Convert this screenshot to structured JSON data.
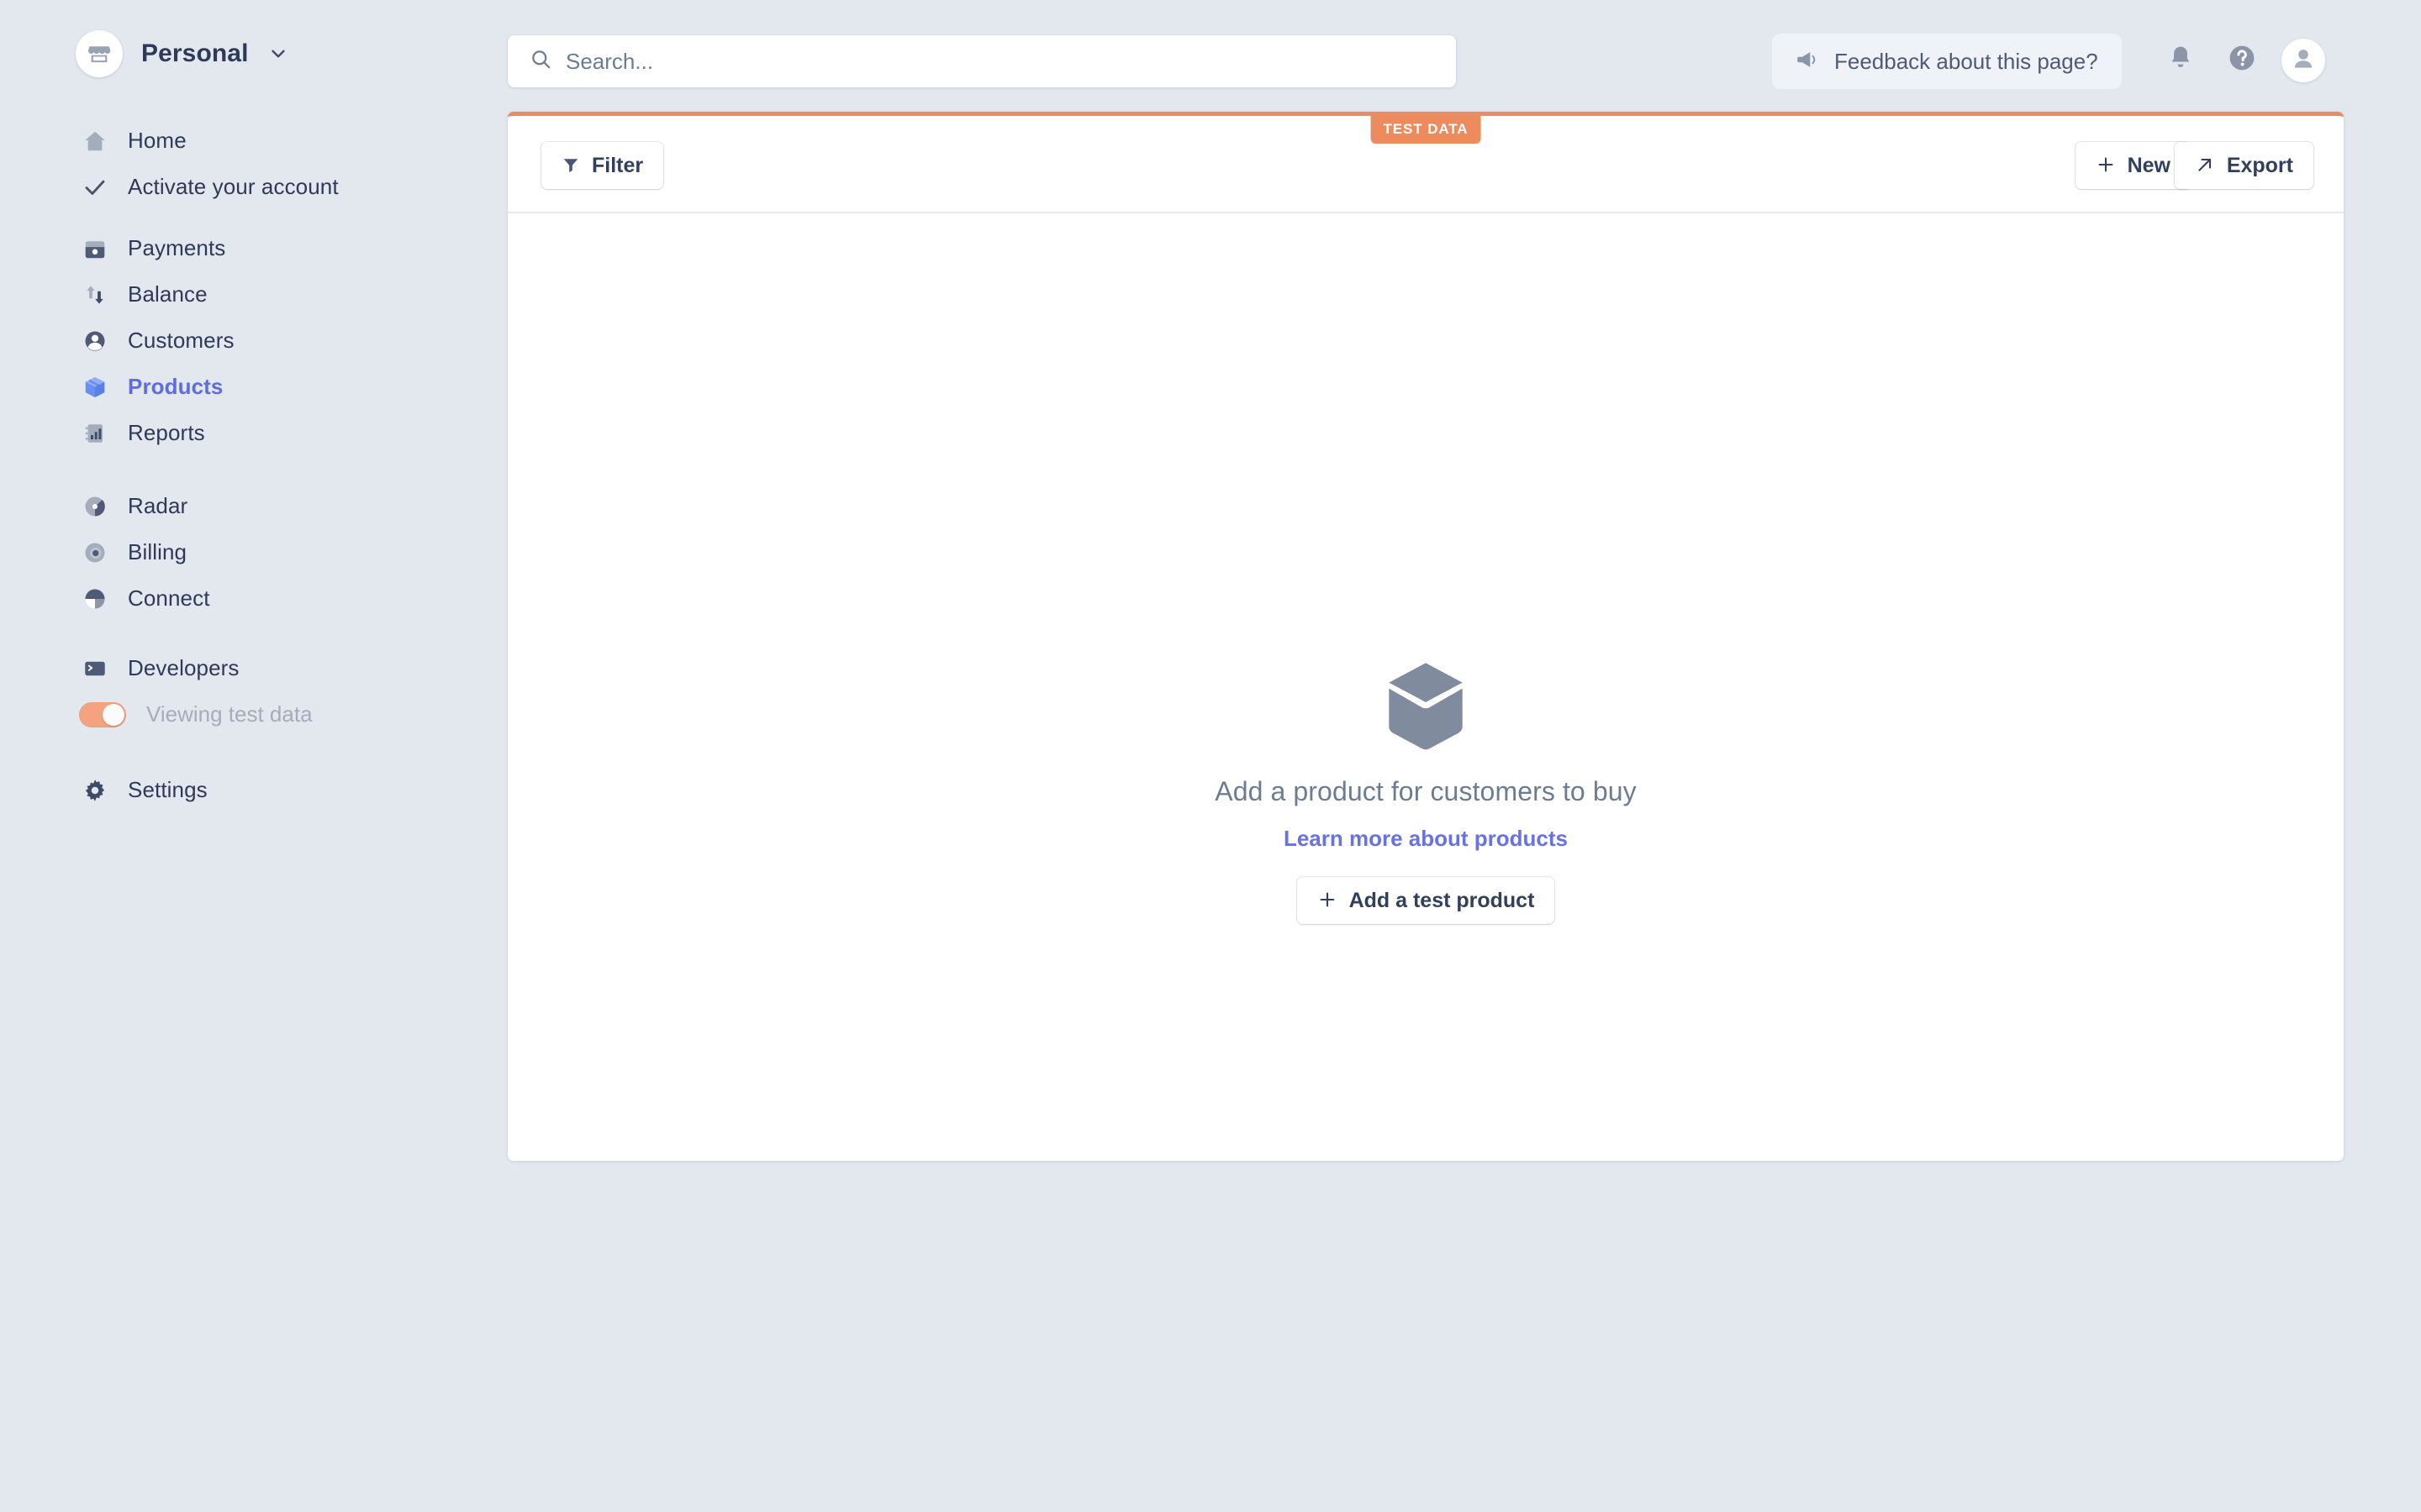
{
  "sidebar": {
    "account": {
      "name": "Personal",
      "logo_icon": "store-icon",
      "chevron_icon": "chevron-down-icon"
    },
    "groups": [
      {
        "items": [
          {
            "label": "Home",
            "icon": "home-icon",
            "active": false
          },
          {
            "label": "Activate your account",
            "icon": "check-icon",
            "active": false
          }
        ]
      },
      {
        "items": [
          {
            "label": "Payments",
            "icon": "payments-icon",
            "active": false
          },
          {
            "label": "Balance",
            "icon": "balance-arrows-icon",
            "active": false
          },
          {
            "label": "Customers",
            "icon": "customers-person-icon",
            "active": false
          },
          {
            "label": "Products",
            "icon": "products-box-icon",
            "active": true
          },
          {
            "label": "Reports",
            "icon": "reports-bars-icon",
            "active": false
          }
        ]
      },
      {
        "items": [
          {
            "label": "Radar",
            "icon": "radar-icon",
            "active": false
          },
          {
            "label": "Billing",
            "icon": "billing-icon",
            "active": false
          },
          {
            "label": "Connect",
            "icon": "connect-icon",
            "active": false
          }
        ]
      },
      {
        "items": [
          {
            "label": "Developers",
            "icon": "terminal-icon",
            "active": false
          }
        ]
      },
      {
        "items": [
          {
            "label": "Settings",
            "icon": "gear-icon",
            "active": false
          }
        ]
      }
    ],
    "test_data_toggle": {
      "label": "Viewing test data",
      "on": true,
      "color": "#f5a281"
    }
  },
  "topbar": {
    "search": {
      "placeholder": "Search...",
      "value": "",
      "icon": "search-icon"
    },
    "feedback": {
      "label": "Feedback about this page?",
      "icon": "megaphone-icon"
    },
    "notifications_icon": "bell-icon",
    "help_icon": "question-circle-icon",
    "avatar_icon": "avatar-icon"
  },
  "content": {
    "badge": "TEST DATA",
    "badge_color": "#ec8b5e",
    "toolbar": {
      "filter_label": "Filter",
      "filter_icon": "funnel-icon",
      "new_label": "New",
      "new_icon": "plus-icon",
      "export_label": "Export",
      "export_icon": "arrow-up-right-icon"
    },
    "empty_state": {
      "icon": "product-box-icon",
      "title": "Add a product for customers to buy",
      "link": "Learn more about products",
      "cta_label": "Add a test product",
      "cta_icon": "plus-icon"
    }
  },
  "colors": {
    "background": "#e3e8ee",
    "accent_blue": "#6772e5",
    "active_nav": "#5f6ce0",
    "test_orange": "#ec8b5e",
    "muted_text": "#6b7c93"
  }
}
